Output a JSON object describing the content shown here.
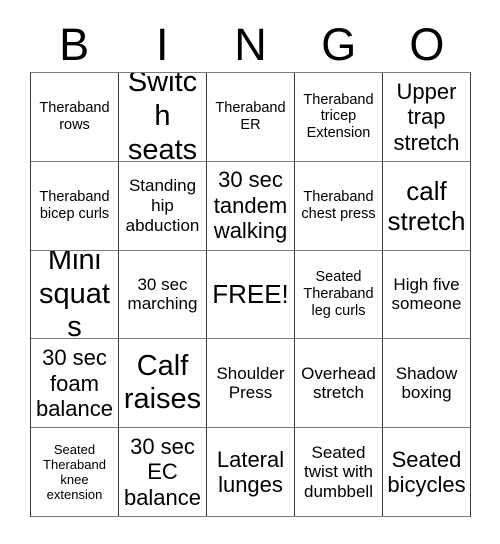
{
  "header": {
    "letters": [
      "B",
      "I",
      "N",
      "G",
      "O"
    ]
  },
  "grid": {
    "columns": 5,
    "rows": 5,
    "cells": [
      {
        "text": "Theraband rows",
        "size": "xs"
      },
      {
        "text": "Switch seats",
        "size": "xl"
      },
      {
        "text": "Theraband ER",
        "size": "xs"
      },
      {
        "text": "Theraband tricep Extension",
        "size": "xs"
      },
      {
        "text": "Upper trap stretch",
        "size": "md"
      },
      {
        "text": "Theraband bicep curls",
        "size": "xs"
      },
      {
        "text": "Standing hip abduction",
        "size": "sm"
      },
      {
        "text": "30 sec tandem walking",
        "size": "md"
      },
      {
        "text": "Theraband chest press",
        "size": "xs"
      },
      {
        "text": "calf stretch",
        "size": "lg"
      },
      {
        "text": "Mini squats",
        "size": "xl"
      },
      {
        "text": "30 sec marching",
        "size": "sm"
      },
      {
        "text": "FREE!",
        "size": "lg"
      },
      {
        "text": "Seated Theraband leg curls",
        "size": "xs"
      },
      {
        "text": "High five someone",
        "size": "sm"
      },
      {
        "text": "30 sec foam balance",
        "size": "md"
      },
      {
        "text": "Calf raises",
        "size": "xl"
      },
      {
        "text": "Shoulder Press",
        "size": "sm"
      },
      {
        "text": "Overhead stretch",
        "size": "sm"
      },
      {
        "text": "Shadow boxing",
        "size": "sm"
      },
      {
        "text": "Seated Theraband knee extension",
        "size": "xxs"
      },
      {
        "text": "30 sec EC balance",
        "size": "md"
      },
      {
        "text": "Lateral lunges",
        "size": "md"
      },
      {
        "text": "Seated twist with dumbbell",
        "size": "sm"
      },
      {
        "text": "Seated bicycles",
        "size": "md"
      }
    ]
  },
  "colors": {
    "background": "#ffffff",
    "text": "#000000",
    "border_vertical": "#3a3a3a",
    "border_horizontal": "#7b7b7b"
  }
}
